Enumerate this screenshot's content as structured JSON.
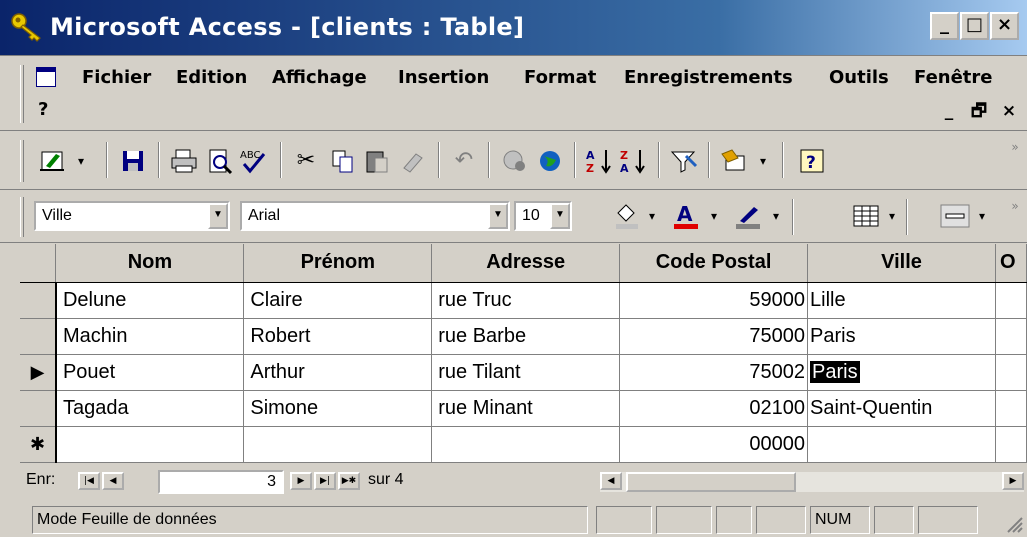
{
  "window": {
    "title": "Microsoft Access - [clients : Table]",
    "minimize": "_",
    "restore": "□",
    "close": "×"
  },
  "menu": {
    "items": [
      "Fichier",
      "Edition",
      "Affichage",
      "Insertion",
      "Format",
      "Enregistrements",
      "Outils",
      "Fenêtre"
    ],
    "help": "?",
    "doc_min": "_",
    "doc_restore": "🗗",
    "doc_close": "×"
  },
  "formatting": {
    "field": "Ville",
    "font": "Arial",
    "size": "10"
  },
  "table": {
    "columns": [
      "Nom",
      "Prénom",
      "Adresse",
      "Code Postal",
      "Ville",
      "O"
    ],
    "rows": [
      {
        "nom": "Delune",
        "prenom": "Claire",
        "adresse": "rue Truc",
        "cp": "59000",
        "ville": "Lille"
      },
      {
        "nom": "Machin",
        "prenom": "Robert",
        "adresse": "rue Barbe",
        "cp": "75000",
        "ville": "Paris"
      },
      {
        "nom": "Pouet",
        "prenom": "Arthur",
        "adresse": "rue Tilant",
        "cp": "75002",
        "ville": "Paris"
      },
      {
        "nom": "Tagada",
        "prenom": "Simone",
        "adresse": "rue Minant",
        "cp": "02100",
        "ville": "Saint-Quentin"
      }
    ],
    "new_row_cp": "00000",
    "current_marker": "▶",
    "new_marker": "✱"
  },
  "nav": {
    "label": "Enr:",
    "current": "3",
    "total_label": "sur 4"
  },
  "status": {
    "mode": "Mode Feuille de données",
    "num": "NUM"
  },
  "colors": {
    "title_start": "#0a246a",
    "title_end": "#a6caf0",
    "chrome": "#d4d0c8",
    "selection": "#000000"
  }
}
